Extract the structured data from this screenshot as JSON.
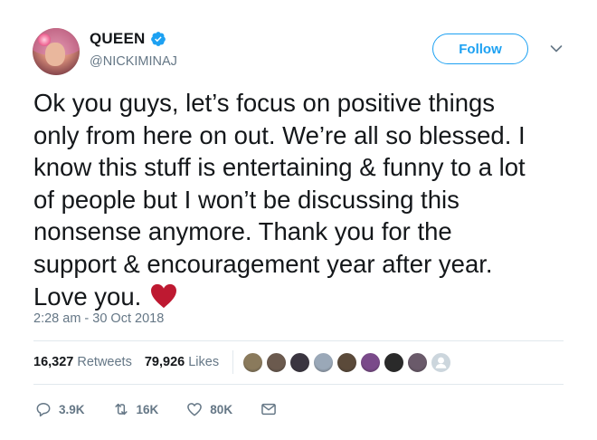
{
  "user": {
    "display_name": "QUEEN",
    "handle": "@NICKIMINAJ",
    "verified": true
  },
  "follow_button": {
    "label": "Follow"
  },
  "tweet": {
    "lines": [
      "Ok you guys, let’s focus on positive things",
      "only from here on out. We’re all so blessed. I",
      "know this stuff is entertaining & funny to a lot",
      "of people but I won’t be discussing this",
      "nonsense anymore. Thank you for the",
      "support & encouragement year after year.",
      "Love you."
    ],
    "emoji": "red-heart",
    "timestamp": "2:28 am - 30 Oct 2018"
  },
  "stats": {
    "retweets_count": "16,327",
    "retweets_label": "Retweets",
    "likes_count": "79,926",
    "likes_label": "Likes"
  },
  "liker_avatars": [
    "#8a7a5c",
    "#6b5a4e",
    "#3a3540",
    "#9aa8b8",
    "#5b4a3a",
    "#7a4a8a",
    "#2a2a2a",
    "#6a5a6a",
    "#ccd6dd"
  ],
  "actions": {
    "replies": "3.9K",
    "retweets": "16K",
    "likes": "80K"
  },
  "colors": {
    "accent": "#1da1f2",
    "muted": "#657786",
    "heart": "#be1931"
  }
}
